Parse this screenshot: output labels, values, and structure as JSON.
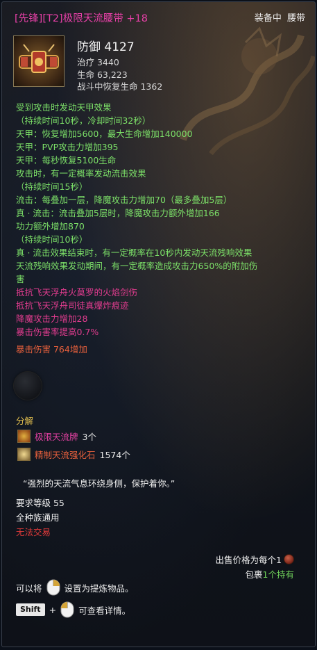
{
  "item": {
    "name": "[先锋][T2]极限天流腰带 +18",
    "equip_status": "装备中",
    "slot": "腰带"
  },
  "stats": {
    "defense": "防御 4127",
    "heal": "治疗 3440",
    "hp": "生命 63,223",
    "combat_regen": "战斗中恢复生命 1362"
  },
  "effects": {
    "green": [
      "受到攻击时发动天甲效果",
      "（持续时间10秒，冷却时间32秒）",
      "天甲：恢复增加5600，最大生命增加140000",
      "天甲：PVP攻击力增加395",
      "天甲：每秒恢复5100生命",
      "攻击时，有一定概率发动流击效果",
      "（持续时间15秒）",
      "流击：每叠加一层，降魔攻击力增加70（最多叠加5层）",
      "真 · 流击：流击叠加5层时，降魔攻击力额外增加166",
      "功力额外增加870",
      "（持续时间10秒）",
      "真 · 流击效果结束时，有一定概率在10秒内发动天流残响效果",
      "天流残响效果发动期间，有一定概率造成攻击力650%的附加伤",
      "害"
    ],
    "pink": [
      "抵抗飞天浮舟火莫罗的火焰剑伤",
      "抵抗飞天浮舟司徒真爆炸痕迹",
      "降魔攻击力增加28",
      "暴击伤害率提高0.7%"
    ],
    "orange": "暴击伤害 764增加"
  },
  "disassemble": {
    "title": "分解",
    "materials": [
      {
        "name": "极限天流牌",
        "count": "3个",
        "color": "#e040a0",
        "icon": "emblem-icon"
      },
      {
        "name": "精制天流强化石",
        "count": "1574个",
        "color": "#e8603c",
        "icon": "enhance-stone-icon"
      }
    ]
  },
  "flavor": "“强烈的天流气息环绕身侧，保护着你。”",
  "requirements": {
    "level": "要求等级 55",
    "race": "全种族通用",
    "trade": "无法交易"
  },
  "sell": {
    "price_label": "出售价格为每个1",
    "inventory_prefix": "包裹",
    "inventory_count": "1个持有"
  },
  "hints": {
    "extract_prefix": "可以将",
    "extract_suffix": "设置为提炼物品。",
    "shift_key": "Shift",
    "plus": "+",
    "detail_suffix": "可查看详情。"
  },
  "colors": {
    "name": "#e840a8",
    "effect_green": "#7ce068",
    "effect_pink": "#e23c8f",
    "effect_orange": "#e8603c",
    "disassemble_title": "#e4c04e"
  }
}
